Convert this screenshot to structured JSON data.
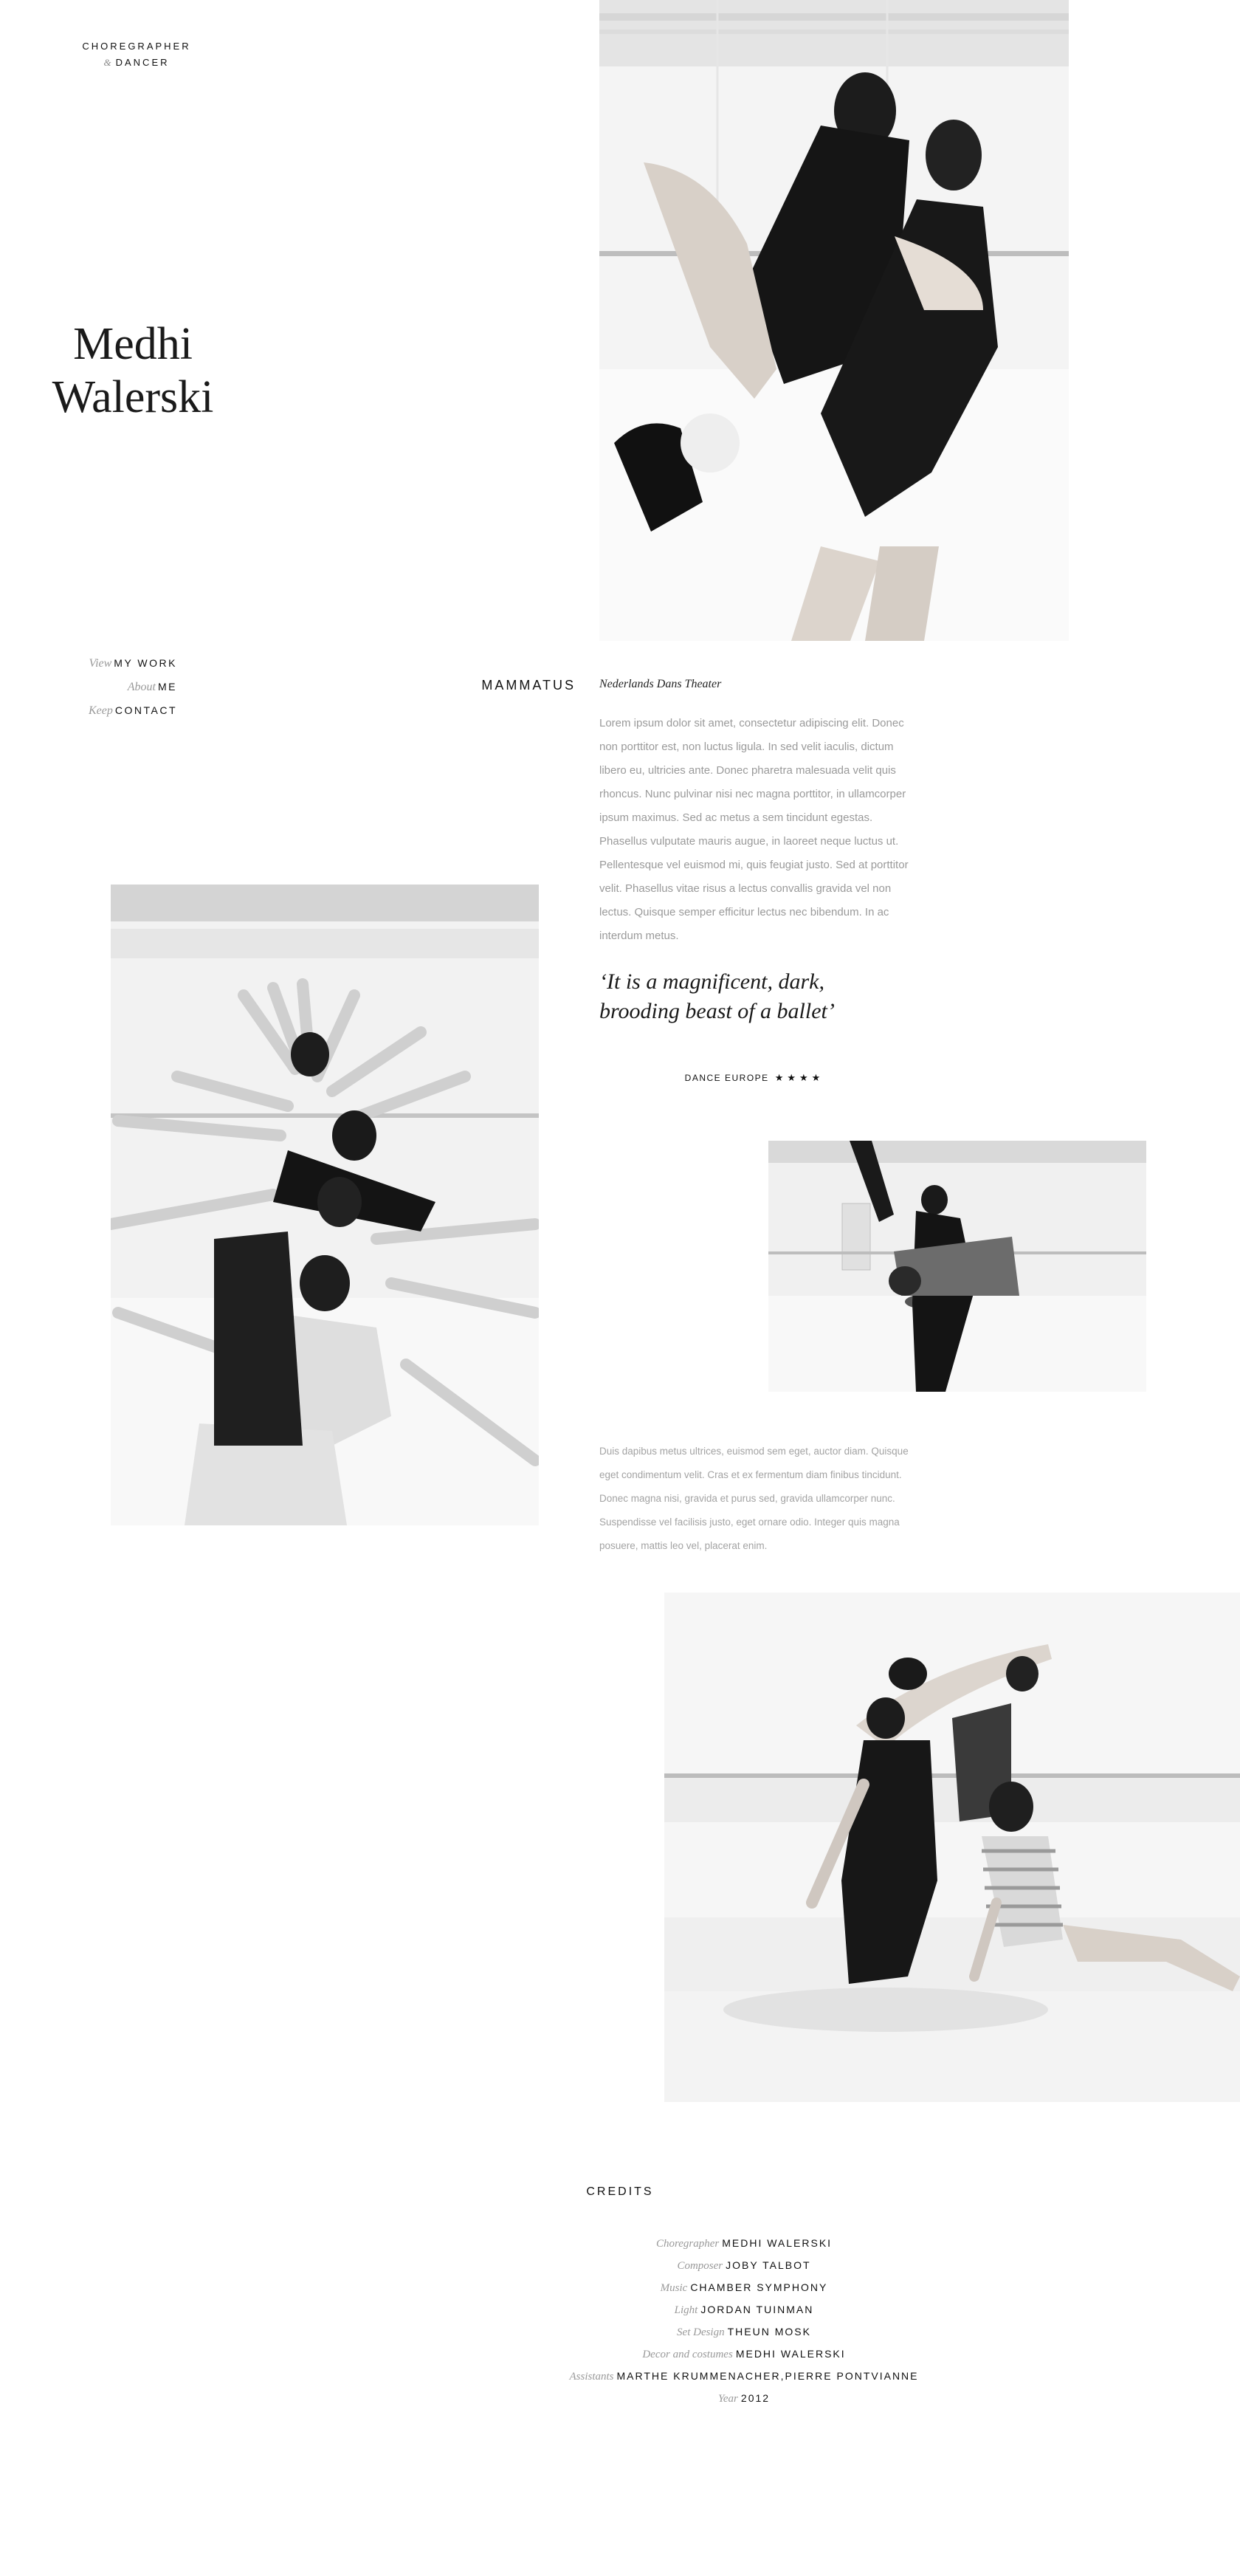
{
  "header": {
    "role_line1": "CHOREGRAPHER",
    "role_amp": "&",
    "role_line2": "DANCER",
    "name_first": "Medhi",
    "name_last": "Walerski"
  },
  "nav": {
    "items": [
      {
        "prefix": "View",
        "label": "MY WORK"
      },
      {
        "prefix": "About",
        "label": "ME"
      },
      {
        "prefix": "Keep",
        "label": "CONTACT"
      }
    ]
  },
  "project": {
    "title": "MAMMATUS",
    "company": "Nederlands Dans Theater",
    "body1": "Lorem ipsum dolor sit amet, consectetur adipiscing elit. Donec non porttitor est, non luctus ligula. In sed velit iaculis, dictum libero eu, ultricies ante. Donec pharetra malesuada velit quis rhoncus. Nunc pulvinar nisi nec magna porttitor, in ullamcorper ipsum maximus. Sed ac metus a sem tincidunt egestas. Phasellus vulputate mauris augue, in laoreet neque luctus ut. Pellentesque vel euismod mi, quis feugiat justo. Sed at porttitor velit. Phasellus vitae risus a lectus convallis gravida vel non lectus. Quisque semper efficitur lectus nec bibendum. In ac interdum metus.",
    "quote": "‘It is a magnificent, dark, brooding beast of a ballet’",
    "quote_source": "DANCE EUROPE",
    "quote_stars": "★★★★",
    "body2": "Duis dapibus metus ultrices, euismod sem eget, auctor diam. Quisque eget condimentum velit. Cras et ex fermentum diam finibus tincidunt. Donec magna nisi, gravida et purus sed, gravida ullamcorper nunc. Suspendisse vel facilisis justo, eget ornare odio. Integer quis magna posuere, mattis leo vel, placerat enim."
  },
  "credits": {
    "title": "CREDITS",
    "rows": [
      {
        "label": "Choregrapher",
        "value": "MEDHI WALERSKI"
      },
      {
        "label": "Composer",
        "value": "JOBY TALBOT"
      },
      {
        "label": "Music",
        "value": "CHAMBER SYMPHONY"
      },
      {
        "label": "Light",
        "value": "JORDAN TUINMAN"
      },
      {
        "label": "Set Design",
        "value": "THEUN MOSK"
      },
      {
        "label": "Decor and costumes",
        "value": "MEDHI WALERSKI"
      },
      {
        "label": "Assistants",
        "value": "MARTHE KRUMMENACHER,PIERRE PONTVIANNE"
      },
      {
        "label": "Year",
        "value": "2012"
      }
    ]
  },
  "colors": {
    "background": "#ffffff",
    "text": "#111111",
    "muted": "#999999"
  }
}
